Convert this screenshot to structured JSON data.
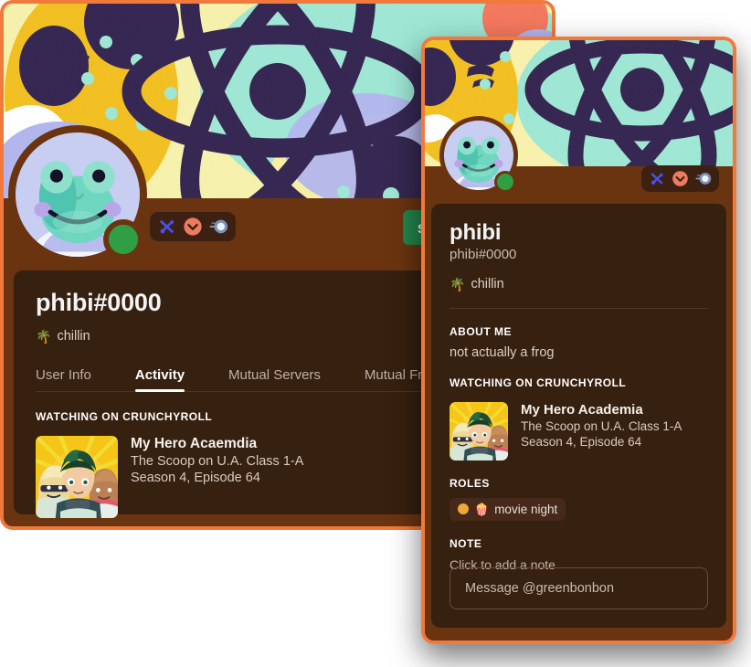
{
  "theme": {
    "card_border": "#f2793c",
    "card_background": "#6b3410",
    "panel_background": "#36200f",
    "accent_green": "#23854b",
    "status_online": "#2f9e44",
    "role_color": "#f0a839"
  },
  "back_card": {
    "name": "user-profile-card-expanded",
    "username": "phibi#0000",
    "custom_status": {
      "emoji": "🌴",
      "text": "chillin"
    },
    "action_button": "Send Friend Request",
    "badges": [
      {
        "name": "discord-staff-badge",
        "title": "Discord Staff"
      },
      {
        "name": "early-supporter-badge",
        "title": "Early Supporter"
      },
      {
        "name": "bug-hunter-badge",
        "title": "Bug Hunter"
      }
    ],
    "tabs": [
      {
        "label": "User Info",
        "active": false
      },
      {
        "label": "Activity",
        "active": true
      },
      {
        "label": "Mutual Servers",
        "active": false
      },
      {
        "label": "Mutual Friends",
        "active": false
      }
    ],
    "activity": {
      "header": "Watching on Crunchyroll",
      "title": "My Hero Acaemdia",
      "detail": "The Scoop on U.A. Class 1-A",
      "state": "Season 4, Episode 64"
    }
  },
  "front_card": {
    "name": "user-profile-card-compact",
    "display_name": "phibi",
    "username": "phibi#0000",
    "custom_status": {
      "emoji": "🌴",
      "text": "chillin"
    },
    "badges": [
      {
        "name": "discord-staff-badge",
        "title": "Discord Staff"
      },
      {
        "name": "early-supporter-badge",
        "title": "Early Supporter"
      },
      {
        "name": "bug-hunter-badge",
        "title": "Bug Hunter"
      }
    ],
    "about_me": {
      "header": "About Me",
      "text": "not actually a frog"
    },
    "activity": {
      "header": "Watching on Crunchyroll",
      "title": "My Hero Academia",
      "detail": "The Scoop on U.A. Class 1-A",
      "state": "Season 4, Episode 64"
    },
    "roles": {
      "header": "Roles",
      "items": [
        {
          "emoji": "🍿",
          "name": "movie night",
          "color": "#f0a839"
        }
      ]
    },
    "note": {
      "header": "Note",
      "placeholder": "Click to add a note"
    },
    "message_input": {
      "placeholder": "Message @greenbonbon",
      "value": ""
    }
  }
}
